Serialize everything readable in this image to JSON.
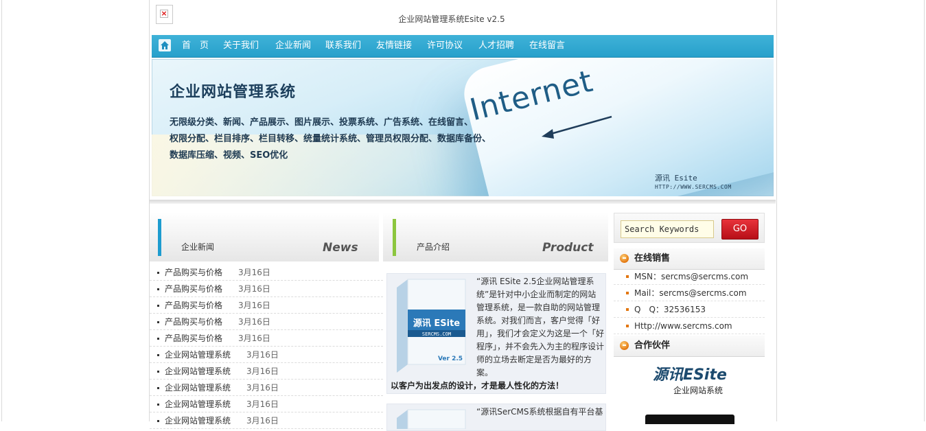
{
  "header": {
    "site_title": "企业网站管理系统Esite v2.5",
    "logo_alt_icon": "broken-image-icon"
  },
  "nav": {
    "items": [
      {
        "label": "首　页"
      },
      {
        "label": "关于我们"
      },
      {
        "label": "企业新闻"
      },
      {
        "label": "联系我们"
      },
      {
        "label": "友情链接"
      },
      {
        "label": "许可协议"
      },
      {
        "label": "人才招聘"
      },
      {
        "label": "在线留言"
      }
    ]
  },
  "banner": {
    "title": "企业网站管理系统",
    "lines": [
      "无限级分类、新闻、产品展示、图片展示、投票系统、广告系统、在线留言、",
      "权限分配、栏目排序、栏目转移、统量统计系统、管理员权限分配、数据库备份、",
      "数据库压缩、视频、SEO优化"
    ],
    "key_text": "Internet",
    "brand": "源讯 Esite",
    "brand_url": "HTTP://WWW.SERCMS.COM"
  },
  "news": {
    "title_cn": "企业新闻",
    "title_en": "News",
    "accent": "#1e9ccf",
    "items": [
      {
        "title": "产品购买与价格",
        "date": "3月16日"
      },
      {
        "title": "产品购买与价格",
        "date": "3月16日"
      },
      {
        "title": "产品购买与价格",
        "date": "3月16日"
      },
      {
        "title": "产品购买与价格",
        "date": "3月16日"
      },
      {
        "title": "产品购买与价格",
        "date": "3月16日"
      },
      {
        "title": "企业网站管理系统",
        "date": "3月16日"
      },
      {
        "title": "企业网站管理系统",
        "date": "3月16日"
      },
      {
        "title": "企业网站管理系统",
        "date": "3月16日"
      },
      {
        "title": "企业网站管理系统",
        "date": "3月16日"
      },
      {
        "title": "企业网站管理系统",
        "date": "3月16日"
      }
    ]
  },
  "products": {
    "title_cn": "产品介绍",
    "title_en": "Product",
    "accent": "#8cc63e",
    "items": [
      {
        "box_title": "源讯 ESite",
        "box_url": "SERCMS.COM",
        "box_ver": "Ver 2.5",
        "desc": "“源讯 ESite 2.5企业网站管理系统”是针对中小企业而制定的网站管理系统，是一款自助的网站管理系统。对我们而言，客户觉得「好用」，我们才会定义为这是一个「好程序」，并不会先入为主的程序设计师的立场去断定是否为最好的方案。",
        "slogan": "以客户为出发点的设计，才是最人性化的方法！"
      },
      {
        "desc": "“源讯SerCMS系统根据自有平台基"
      }
    ]
  },
  "sidebar": {
    "search_placeholder": "Search Keywords",
    "search_button": "GO",
    "online_sales_title": "在线销售",
    "contacts": [
      "MSN：sercms@sercms.com",
      "Mail：sercms@sercms.com",
      "Q　Q：32536153",
      "Http://www.sercms.com"
    ],
    "partners_title": "合作伙伴",
    "partner_logo_main": "源讯ESite",
    "partner_logo_sub": "企业网站系统",
    "accent_orange": "#e2760f",
    "go_red": "#d3141c"
  }
}
